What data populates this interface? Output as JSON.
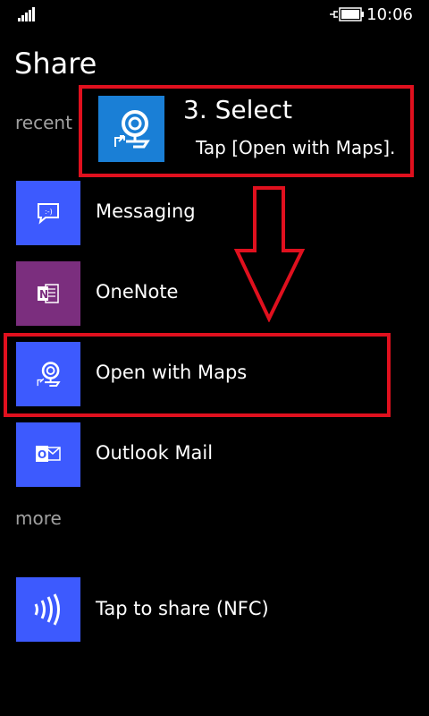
{
  "status": {
    "time": "10:06"
  },
  "page": {
    "title": "Share"
  },
  "sections": {
    "recent": "recent",
    "more": "more"
  },
  "callout": {
    "title": "3. Select",
    "text": "Tap [Open with Maps]."
  },
  "apps": [
    {
      "label": "Messaging",
      "icon": "messaging-icon",
      "color": "#3d5afe"
    },
    {
      "label": "OneNote",
      "icon": "onenote-icon",
      "color": "#7b2e7e"
    },
    {
      "label": "Open with Maps",
      "icon": "maps-icon",
      "color": "#3d5afe"
    },
    {
      "label": "Outlook Mail",
      "icon": "outlook-mail-icon",
      "color": "#3d5afe"
    }
  ],
  "more_apps": [
    {
      "label": "Tap to share (NFC)",
      "icon": "nfc-icon",
      "color": "#3d5afe"
    }
  ],
  "colors": {
    "accent": "#3d5afe",
    "annotation": "#e0101e",
    "onenote": "#7b2e7e",
    "callout_tile": "#1a7fd6"
  }
}
